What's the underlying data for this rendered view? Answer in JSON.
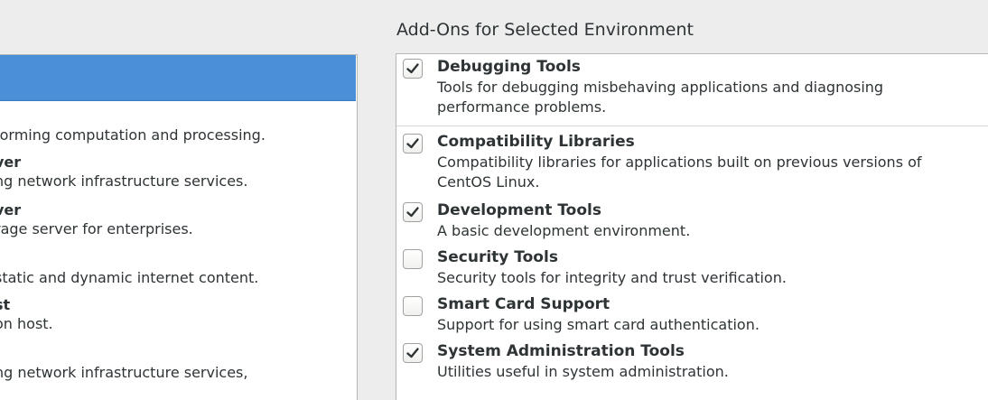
{
  "addons_heading": "Add-Ons for Selected Environment",
  "environments": [
    {
      "title": "",
      "desc": "forming computation and processing."
    },
    {
      "title": "ver",
      "desc": "ng network infrastructure services."
    },
    {
      "title": "ver",
      "desc": "rage server for enterprises."
    },
    {
      "title": "",
      "desc": "static and dynamic internet content."
    },
    {
      "title": "st",
      "desc": "on host."
    },
    {
      "title": "",
      "desc": "ng network infrastructure services,"
    }
  ],
  "addons": [
    {
      "name": "Debugging Tools",
      "desc": "Tools for debugging misbehaving applications and diagnosing performance problems.",
      "checked": true
    },
    {
      "name": "Compatibility Libraries",
      "desc": "Compatibility libraries for applications built on previous versions of CentOS Linux.",
      "checked": true
    },
    {
      "name": "Development Tools",
      "desc": "A basic development environment.",
      "checked": true
    },
    {
      "name": "Security Tools",
      "desc": "Security tools for integrity and trust verification.",
      "checked": false
    },
    {
      "name": "Smart Card Support",
      "desc": "Support for using smart card authentication.",
      "checked": false
    },
    {
      "name": "System Administration Tools",
      "desc": "Utilities useful in system administration.",
      "checked": true
    }
  ],
  "colors": {
    "selection": "#4a90d9",
    "panel_bg": "#ffffff",
    "window_bg": "#ededed",
    "text": "#2e3436"
  }
}
